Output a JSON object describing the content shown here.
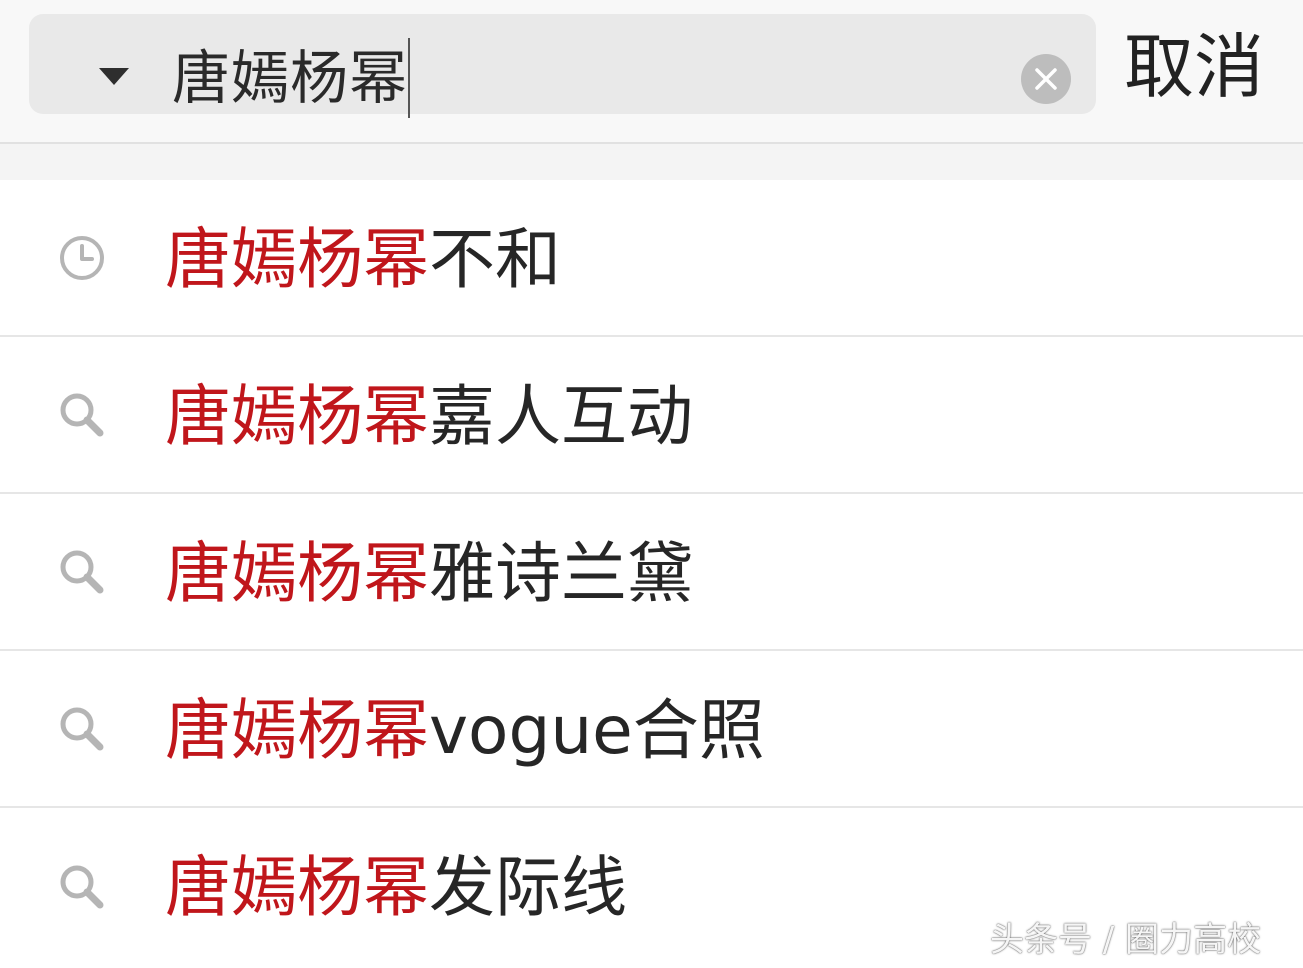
{
  "search": {
    "query": "唐嫣杨幂",
    "cancel_label": "取消"
  },
  "suggestions": [
    {
      "icon": "clock-icon",
      "highlight": "唐嫣杨幂",
      "rest": "不和"
    },
    {
      "icon": "search-icon",
      "highlight": "唐嫣杨幂",
      "rest": "嘉人互动"
    },
    {
      "icon": "search-icon",
      "highlight": "唐嫣杨幂",
      "rest": "雅诗兰黛"
    },
    {
      "icon": "search-icon",
      "highlight": "唐嫣杨幂",
      "rest": "vogue合照"
    },
    {
      "icon": "search-icon",
      "highlight": "唐嫣杨幂",
      "rest": "发际线"
    }
  ],
  "watermark": {
    "text": "头条号 / 圈力高校"
  },
  "colors": {
    "highlight": "#c0161b",
    "text": "#262626",
    "header_bg": "#f8f8f8",
    "search_box_bg": "#e9e9e9",
    "clear_button_bg": "#bdbdbd",
    "divider": "#e6e6e6"
  }
}
